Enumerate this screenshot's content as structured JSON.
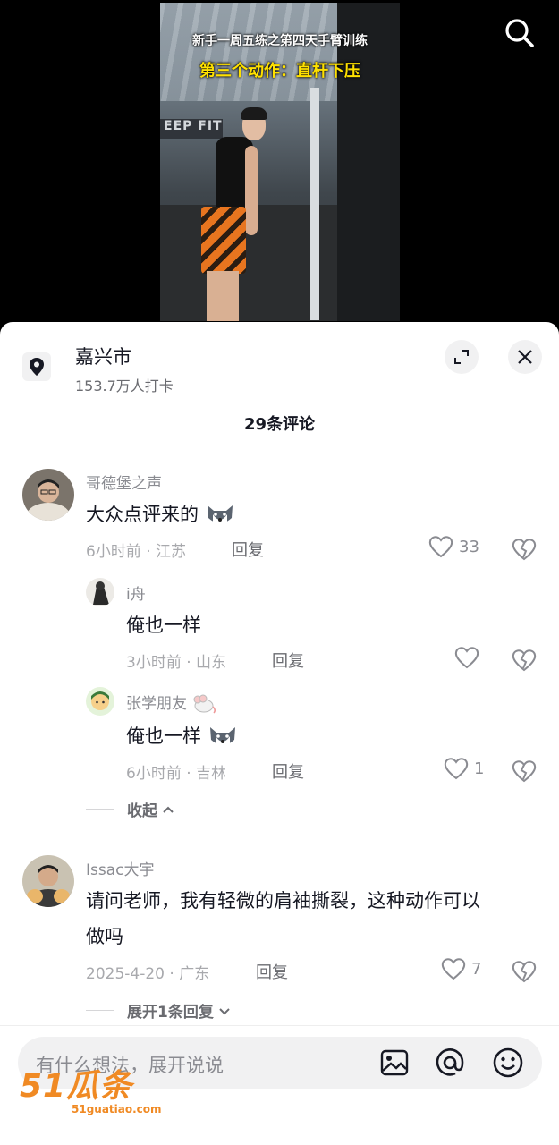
{
  "video": {
    "caption_line1": "新手一周五练之第四天手臂训练",
    "caption_line2": "第三个动作：直杆下压",
    "gym_sign": "EEP FIT"
  },
  "location": {
    "title": "嘉兴市",
    "checkins": "153.7万人打卡"
  },
  "comments_header": "29条评论",
  "comments": [
    {
      "username": "哥德堡之声",
      "text": "大众点评来的",
      "time_location": "6小时前 · 江苏",
      "reply_label": "回复",
      "likes": "33",
      "replies": [
        {
          "username": "i舟",
          "text": "俺也一样",
          "time_location": "3小时前 · 山东",
          "reply_label": "回复",
          "likes": ""
        },
        {
          "username": "张学朋友",
          "text": "俺也一样",
          "time_location": "6小时前 · 吉林",
          "reply_label": "回复",
          "likes": "1"
        }
      ],
      "fold_label": "收起"
    },
    {
      "username": "Issac大宇",
      "text_line1": "请问老师，我有轻微的肩袖撕裂，这种动作可以",
      "text_line2": "做吗",
      "time_location": "2025-4-20 · 广东",
      "reply_label": "回复",
      "likes": "7",
      "expand_label": "展开1条回复"
    }
  ],
  "input": {
    "placeholder": "有什么想法，展开说说"
  },
  "watermark": {
    "main": "51瓜条",
    "sub": "51guatiao.com"
  },
  "icons": {
    "search": "search-icon",
    "location": "location-pin-icon",
    "expand": "expand-icon",
    "close": "close-icon",
    "like": "heart-icon",
    "dislike": "broken-heart-icon",
    "image": "image-icon",
    "mention": "at-icon",
    "emoji": "emoji-icon"
  }
}
